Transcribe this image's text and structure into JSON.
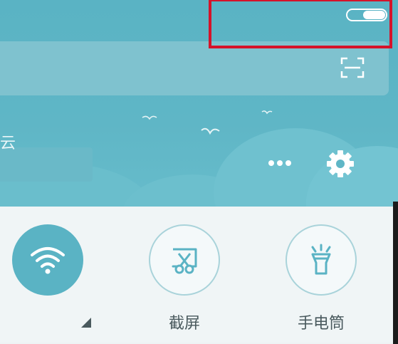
{
  "header": {
    "account_fragment": "云",
    "toggle_state": "on"
  },
  "icons": {
    "scan": "scan-icon",
    "more": "more-dots-icon",
    "settings": "gear-icon"
  },
  "quick_tiles": [
    {
      "id": "wifi",
      "label": "",
      "icon": "wifi-icon",
      "active": true
    },
    {
      "id": "screenshot",
      "label": "截屏",
      "icon": "scissors-icon",
      "active": false
    },
    {
      "id": "flashlight",
      "label": "手电筒",
      "icon": "flashlight-icon",
      "active": false
    }
  ],
  "colors": {
    "header_bg": "#5ab3c4",
    "active_tile": "#5ab3c4",
    "highlight_border": "#d5132a",
    "panel_bg": "#f0f5f6"
  }
}
